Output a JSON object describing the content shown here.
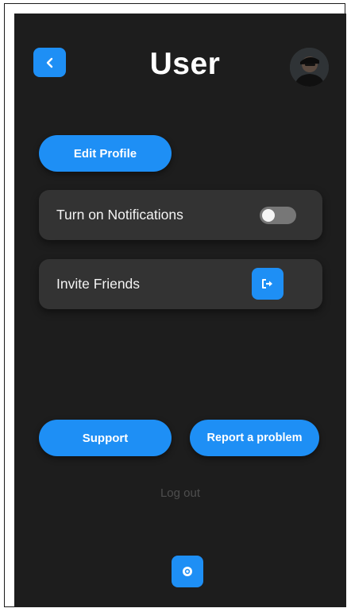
{
  "header": {
    "title": "User",
    "back_icon": "chevron-left-icon",
    "avatar_alt": "user avatar"
  },
  "profile": {
    "edit_label": "Edit Profile"
  },
  "settings": {
    "notifications_label": "Turn on Notifications",
    "notifications_enabled": false,
    "invite_label": "Invite Friends",
    "invite_icon": "share-arrow-icon"
  },
  "actions": {
    "support_label": "Support",
    "report_label": "Report a problem",
    "logout_label": "Log out"
  },
  "footer": {
    "settings_icon": "gear-icon"
  },
  "colors": {
    "background": "#1d1d1d",
    "card": "#333333",
    "accent": "#1e8ff5",
    "muted_text": "#4e4e4e"
  }
}
